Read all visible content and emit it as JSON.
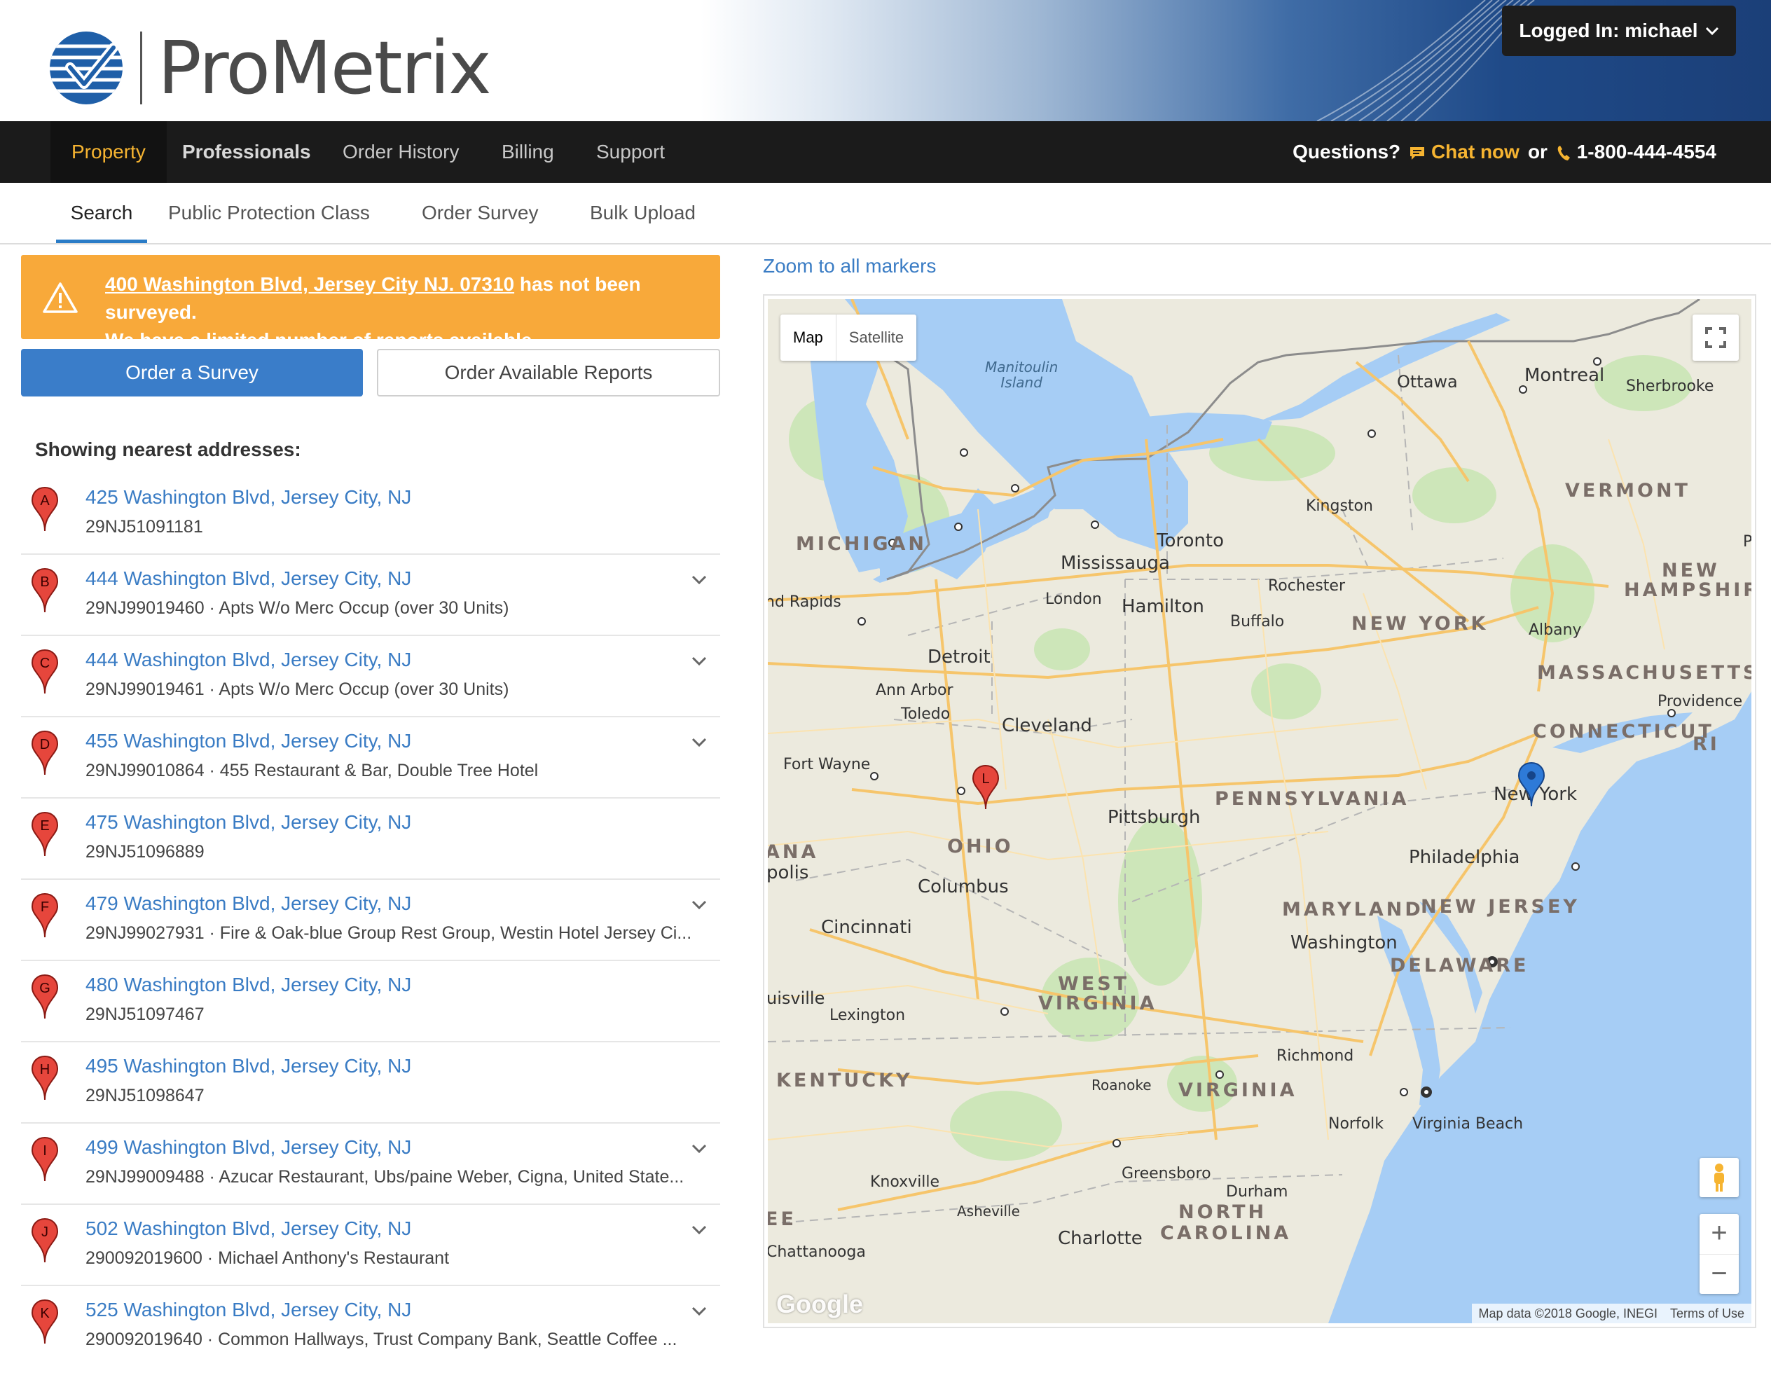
{
  "brand": {
    "name": "ProMetrix"
  },
  "user": {
    "label": "Logged In: michael"
  },
  "nav": {
    "items": [
      "Property",
      "Professionals",
      "Order History",
      "Billing",
      "Support"
    ],
    "help": {
      "question": "Questions?",
      "chat": "Chat now",
      "or": "or",
      "phone": "1-800-444-4554"
    }
  },
  "subnav": {
    "items": [
      "Search",
      "Public Protection Class",
      "Order Survey",
      "Bulk Upload"
    ]
  },
  "alert": {
    "address": "400 Washington Blvd, Jersey City NJ. 07310",
    "line1_rest": " has not been surveyed.",
    "line2": "We have a limited number of reports available."
  },
  "buttons": {
    "order_survey": "Order a Survey",
    "order_reports": "Order Available Reports"
  },
  "results": {
    "heading": "Showing nearest addresses:",
    "items": [
      {
        "marker": "A",
        "address": "425 Washington Blvd, Jersey City, NJ",
        "detail": "29NJ51091181",
        "expandable": false
      },
      {
        "marker": "B",
        "address": "444 Washington Blvd, Jersey City, NJ",
        "detail": "29NJ99019460 · Apts W/o Merc Occup (over 30 Units)",
        "expandable": true
      },
      {
        "marker": "C",
        "address": "444 Washington Blvd, Jersey City, NJ",
        "detail": "29NJ99019461 · Apts W/o Merc Occup (over 30 Units)",
        "expandable": true
      },
      {
        "marker": "D",
        "address": "455 Washington Blvd, Jersey City, NJ",
        "detail": "29NJ99010864 · 455 Restaurant & Bar, Double Tree Hotel",
        "expandable": true
      },
      {
        "marker": "E",
        "address": "475 Washington Blvd, Jersey City, NJ",
        "detail": "29NJ51096889",
        "expandable": false
      },
      {
        "marker": "F",
        "address": "479 Washington Blvd, Jersey City, NJ",
        "detail": "29NJ99027931 · Fire & Oak-blue Group Rest Group, Westin Hotel Jersey Ci...",
        "expandable": true
      },
      {
        "marker": "G",
        "address": "480 Washington Blvd, Jersey City, NJ",
        "detail": "29NJ51097467",
        "expandable": false
      },
      {
        "marker": "H",
        "address": "495 Washington Blvd, Jersey City, NJ",
        "detail": "29NJ51098647",
        "expandable": false
      },
      {
        "marker": "I",
        "address": "499 Washington Blvd, Jersey City, NJ",
        "detail": "29NJ99009488 · Azucar Restaurant, Ubs/paine Weber, Cigna, United State...",
        "expandable": true
      },
      {
        "marker": "J",
        "address": "502 Washington Blvd, Jersey City, NJ",
        "detail": "290092019600 · Michael Anthony's Restaurant",
        "expandable": true
      },
      {
        "marker": "K",
        "address": "525 Washington Blvd, Jersey City, NJ",
        "detail": "290092019640 · Common Hallways, Trust Company Bank, Seattle Coffee ...",
        "expandable": true
      }
    ]
  },
  "map": {
    "zoom_link": "Zoom to all markers",
    "type_options": [
      "Map",
      "Satellite"
    ],
    "marker_l": "L",
    "attribution": [
      "Map data ©2018 Google, INEGI",
      "Terms of Use"
    ],
    "google_logo": "Google",
    "zoom_in": "+",
    "zoom_out": "−",
    "water_labels": [
      "Manitoulin\nIsland"
    ],
    "city_labels": [
      "Ottawa",
      "Montreal",
      "Sherbrooke",
      "Kingston",
      "Toronto",
      "Mississauga",
      "London",
      "Hamilton",
      "Rochester",
      "Buffalo",
      "Albany",
      "Detroit",
      "Ann Arbor",
      "Toledo",
      "Cleveland",
      "Fort Wayne",
      "Pittsburgh",
      "Providence",
      "New York",
      "Philadelphia",
      "Columbus",
      "Cincinnati",
      "Washington",
      "Lexington",
      "Richmond",
      "Roanoke",
      "Norfolk",
      "Virginia Beach",
      "Greensboro",
      "Durham",
      "Knoxville",
      "Asheville",
      "Charlotte",
      "Chattanooga",
      "nd Rapids",
      "uisville",
      "polis",
      "P"
    ],
    "state_labels": [
      "VERMONT",
      "MICHIGAN",
      "NEW",
      "HAMPSHIRE",
      "NEW YORK",
      "MASSACHUSETTS",
      "CONNECTICUT",
      "RI",
      "PENNSYLVANIA",
      "OHIO",
      "ANA",
      "MARYLAND",
      "NEW JERSEY",
      "DELAWARE",
      "WEST",
      "VIRGINIA",
      "KENTUCKY",
      "VIRGINIA",
      "NORTH",
      "CAROLINA",
      "EE"
    ]
  }
}
